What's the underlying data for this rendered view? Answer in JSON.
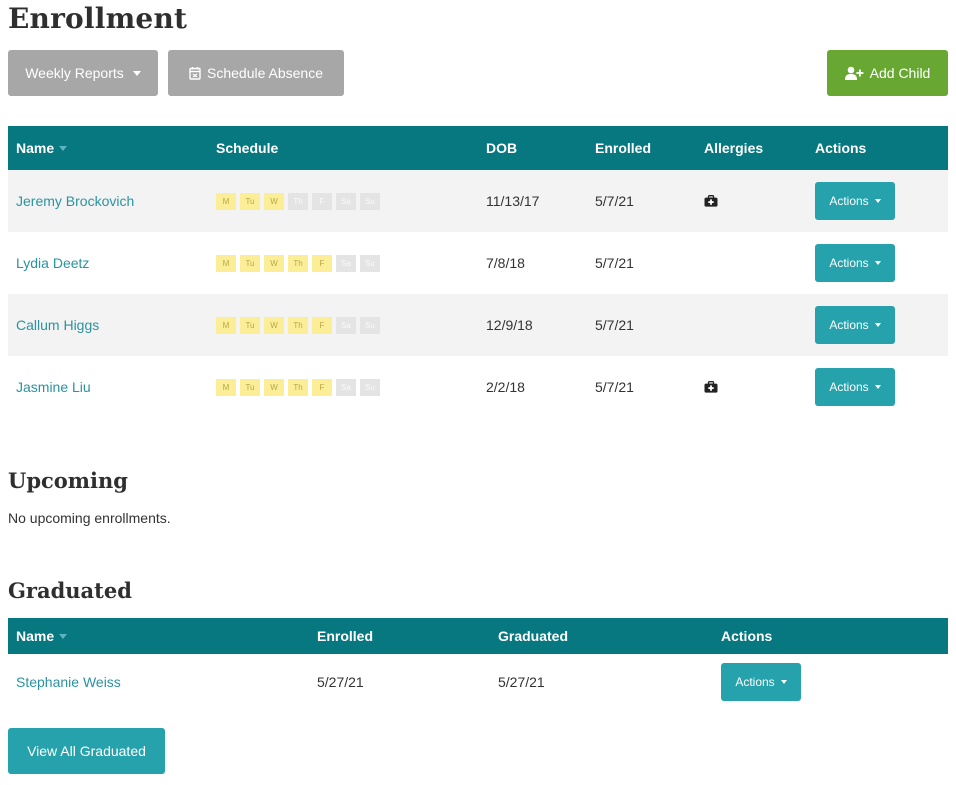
{
  "page": {
    "title": "Enrollment"
  },
  "toolbar": {
    "weekly_reports": "Weekly Reports",
    "schedule_absence": "Schedule Absence",
    "add_child": "Add Child"
  },
  "enrollment_table": {
    "columns": {
      "name": "Name",
      "schedule": "Schedule",
      "dob": "DOB",
      "enrolled": "Enrolled",
      "allergies": "Allergies",
      "actions": "Actions"
    },
    "day_labels": [
      "M",
      "Tu",
      "W",
      "Th",
      "F",
      "Sa",
      "Su"
    ],
    "action_label": "Actions",
    "rows": [
      {
        "name": "Jeremy Brockovich",
        "schedule": [
          true,
          true,
          true,
          false,
          false,
          false,
          false
        ],
        "dob": "11/13/17",
        "enrolled": "5/7/21",
        "allergy_icon": "medical-kit-icon",
        "has_allergy": true
      },
      {
        "name": "Lydia Deetz",
        "schedule": [
          true,
          true,
          true,
          true,
          true,
          false,
          false
        ],
        "dob": "7/8/18",
        "enrolled": "5/7/21",
        "has_allergy": false
      },
      {
        "name": "Callum Higgs",
        "schedule": [
          true,
          true,
          true,
          true,
          true,
          false,
          false
        ],
        "dob": "12/9/18",
        "enrolled": "5/7/21",
        "has_allergy": false
      },
      {
        "name": "Jasmine Liu",
        "schedule": [
          true,
          true,
          true,
          true,
          true,
          false,
          false
        ],
        "dob": "2/2/18",
        "enrolled": "5/7/21",
        "allergy_icon": "medical-kit-icon",
        "has_allergy": true
      }
    ]
  },
  "upcoming": {
    "title": "Upcoming",
    "empty_text": "No upcoming enrollments."
  },
  "graduated": {
    "title": "Graduated",
    "columns": {
      "name": "Name",
      "enrolled": "Enrolled",
      "graduated": "Graduated",
      "actions": "Actions"
    },
    "action_label": "Actions",
    "rows": [
      {
        "name": "Stephanie Weiss",
        "enrolled": "5/27/21",
        "graduated": "5/27/21"
      }
    ],
    "view_all": "View All Graduated"
  },
  "colors": {
    "header_teal": "#087880",
    "link_teal": "#2a93a0",
    "button_teal": "#25a2ab",
    "button_green": "#68a832",
    "button_grey": "#a7a7a7",
    "schedule_on": "#fbee96",
    "schedule_off": "#e4e4e4"
  }
}
